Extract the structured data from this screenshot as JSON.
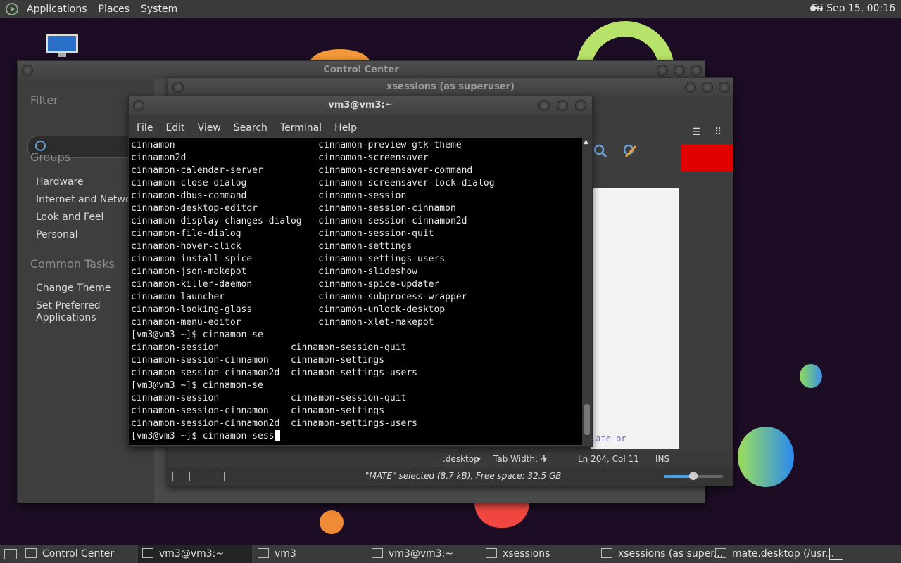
{
  "top_panel": {
    "menus": [
      "Applications",
      "Places",
      "System"
    ],
    "clock": "Fri Sep 15, 00:16"
  },
  "control_center": {
    "title": "Control Center",
    "filter_heading": "Filter",
    "groups_heading": "Groups",
    "groups": [
      "Hardware",
      "Internet and Network",
      "Look and Feel",
      "Personal"
    ],
    "tasks_heading": "Common Tasks",
    "tasks": [
      "Change Theme",
      "Set Preferred",
      "Applications"
    ]
  },
  "xsessions": {
    "title": "xsessions (as superuser)",
    "status_syntax": ".desktop",
    "status_tab": "Tab Width:  4",
    "status_pos": "Ln 204, Col 11",
    "status_mode": "INS",
    "bottom_status": "\"MATE\" selected (8.7 kB), Free space: 32.5 GB",
    "code_fragment": "late or"
  },
  "terminal": {
    "title": "vm3@vm3:~",
    "menu": [
      "File",
      "Edit",
      "View",
      "Search",
      "Terminal",
      "Help"
    ],
    "lines": [
      "cinnamon                          cinnamon-preview-gtk-theme",
      "cinnamon2d                        cinnamon-screensaver",
      "cinnamon-calendar-server          cinnamon-screensaver-command",
      "cinnamon-close-dialog             cinnamon-screensaver-lock-dialog",
      "cinnamon-dbus-command             cinnamon-session",
      "cinnamon-desktop-editor           cinnamon-session-cinnamon",
      "cinnamon-display-changes-dialog   cinnamon-session-cinnamon2d",
      "cinnamon-file-dialog              cinnamon-session-quit",
      "cinnamon-hover-click              cinnamon-settings",
      "cinnamon-install-spice            cinnamon-settings-users",
      "cinnamon-json-makepot             cinnamon-slideshow",
      "cinnamon-killer-daemon            cinnamon-spice-updater",
      "cinnamon-launcher                 cinnamon-subprocess-wrapper",
      "cinnamon-looking-glass            cinnamon-unlock-desktop",
      "cinnamon-menu-editor              cinnamon-xlet-makepot",
      "[vm3@vm3 ~]$ cinnamon-se",
      "cinnamon-session             cinnamon-session-quit",
      "cinnamon-session-cinnamon    cinnamon-settings",
      "cinnamon-session-cinnamon2d  cinnamon-settings-users",
      "[vm3@vm3 ~]$ cinnamon-se",
      "cinnamon-session             cinnamon-session-quit",
      "cinnamon-session-cinnamon    cinnamon-settings",
      "cinnamon-session-cinnamon2d  cinnamon-settings-users"
    ],
    "prompt": "[vm3@vm3 ~]$ cinnamon-sess"
  },
  "taskbar": [
    {
      "label": "Control Center",
      "icon": "control-center-icon"
    },
    {
      "label": "vm3@vm3:~",
      "icon": "terminal-icon",
      "active": true
    },
    {
      "label": "vm3",
      "icon": "folder-home-icon"
    },
    {
      "label": "vm3@vm3:~",
      "icon": "terminal-icon"
    },
    {
      "label": "xsessions",
      "icon": "folder-icon"
    },
    {
      "label": "xsessions (as super...",
      "icon": "folder-icon"
    },
    {
      "label": "mate.desktop (/usr...",
      "icon": "text-editor-icon"
    }
  ],
  "colors": {
    "panel": "#3a3a3a",
    "desktop": "#1c0d24",
    "terminal_bg": "#000000",
    "accent_red": "#e00000"
  }
}
